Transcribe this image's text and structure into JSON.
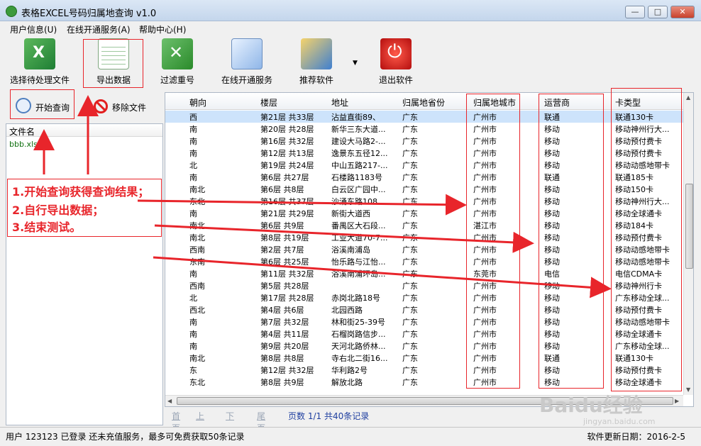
{
  "window": {
    "title": "表格EXCEL号码归属地查询 v1.0",
    "minimize_label": "—",
    "maximize_label": "□",
    "close_label": "✕"
  },
  "menu": [
    "用户信息(U)",
    "在线开通服务(A)",
    "帮助中心(H)"
  ],
  "toolbar": [
    {
      "label": "选择待处理文件",
      "icon": "excel-icon"
    },
    {
      "label": "导出数据",
      "icon": "spreadsheet-icon"
    },
    {
      "label": "过滤重号",
      "icon": "filter-icon"
    },
    {
      "label": "在线开通服务",
      "icon": "document-icon"
    },
    {
      "label": "推荐软件",
      "icon": "software-box-icon"
    },
    {
      "label": "退出软件",
      "icon": "power-icon"
    }
  ],
  "actions": {
    "start_query": "开始查询",
    "remove_file": "移除文件"
  },
  "files": {
    "header": "文件名",
    "items": [
      "bbb.xls"
    ]
  },
  "annotation": {
    "lines": [
      "1.开始查询获得查询结果；",
      "2.自行导出数据；",
      "3.结束测试。"
    ]
  },
  "grid": {
    "columns": [
      "朝向",
      "楼层",
      "地址",
      "归属地省份",
      "归属地城市",
      "运营商",
      "卡类型"
    ],
    "rows": [
      [
        "西",
        "第21层 共33层",
        "沾益直街89、",
        "广东",
        "广州市",
        "联通",
        "联通130卡"
      ],
      [
        "南",
        "第20层 共28层",
        "新华三东大道...",
        "广东",
        "广州市",
        "移动",
        "移动神州行大..."
      ],
      [
        "南",
        "第16层 共32层",
        "建设大马路2-...",
        "广东",
        "广州市",
        "移动",
        "移动预付费卡"
      ],
      [
        "南",
        "第12层 共13层",
        "逸景东五径12...",
        "广东",
        "广州市",
        "移动",
        "移动预付费卡"
      ],
      [
        "北",
        "第19层 共24层",
        "中山五路217-...",
        "广东",
        "广州市",
        "移动",
        "移动动感地带卡"
      ],
      [
        "南",
        "第6层 共27层",
        "石楼路1183号",
        "广东",
        "广州市",
        "联通",
        "联通185卡"
      ],
      [
        "南北",
        "第6层 共8层",
        "白云区广园中...",
        "广东",
        "广州市",
        "移动",
        "移动150卡"
      ],
      [
        "东北",
        "第16层 共37层",
        "沙涌东路108...",
        "广东",
        "广州市",
        "移动",
        "移动神州行大..."
      ],
      [
        "南",
        "第21层 共29层",
        "新街大道西",
        "广东",
        "广州市",
        "移动",
        "移动全球通卡"
      ],
      [
        "南北",
        "第6层 共9层",
        "番禺区大石段...",
        "广东",
        "湛江市",
        "移动",
        "移动184卡"
      ],
      [
        "南北",
        "第8层 共19层",
        "工业大道70-7...",
        "广东",
        "广州市",
        "移动",
        "移动预付费卡"
      ],
      [
        "西南",
        "第2层 共7层",
        "浴溪南浦岛",
        "广东",
        "广州市",
        "移动",
        "移动动感地带卡"
      ],
      [
        "东南",
        "第6层 共25层",
        "怡乐路与江怡...",
        "广东",
        "广州市",
        "移动",
        "移动动感地带卡"
      ],
      [
        "南",
        "第11层 共32层",
        "浴溪南浦环岛...",
        "广东",
        "东莞市",
        "电信",
        "电信CDMA卡"
      ],
      [
        "西南",
        "第5层 共28层",
        "",
        "广东",
        "广州市",
        "移动",
        "移动神州行卡"
      ],
      [
        "北",
        "第17层 共28层",
        "赤岗北路18号",
        "广东",
        "广州市",
        "移动",
        "广东移动全球..."
      ],
      [
        "西北",
        "第4层 共6层",
        "北园西路",
        "广东",
        "广州市",
        "移动",
        "移动预付费卡"
      ],
      [
        "南",
        "第7层 共32层",
        "林和街25-39号",
        "广东",
        "广州市",
        "移动",
        "移动动感地带卡"
      ],
      [
        "南",
        "第4层 共11层",
        "石榴岗路信步...",
        "广东",
        "广州市",
        "移动",
        "移动全球通卡"
      ],
      [
        "南",
        "第9层 共20层",
        "天河北路侨林...",
        "广东",
        "广州市",
        "移动",
        "广东移动全球..."
      ],
      [
        "南北",
        "第8层 共8层",
        "寺右北二街16...",
        "广东",
        "广州市",
        "联通",
        "联通130卡"
      ],
      [
        "东",
        "第12层 共32层",
        "华利路2号",
        "广东",
        "广州市",
        "移动",
        "移动预付费卡"
      ],
      [
        "东北",
        "第8层 共9层",
        "解放北路",
        "广东",
        "广州市",
        "移动",
        "移动全球通卡"
      ]
    ]
  },
  "pager": {
    "first": "首页",
    "prev": "上一页",
    "next": "下一页",
    "last": "尾页",
    "info": "页数 1/1 共40条记录"
  },
  "status": {
    "left": "用户 123123 已登录 还未充值服务，最多可免费获取50条记录",
    "right": "软件更新日期：2016-2-5"
  },
  "watermark": {
    "brand": "Baidu经验",
    "site": "jingyan.baidu.com"
  },
  "colors": {
    "highlight": "#e8252b",
    "selected_row": "#cde3fb"
  }
}
